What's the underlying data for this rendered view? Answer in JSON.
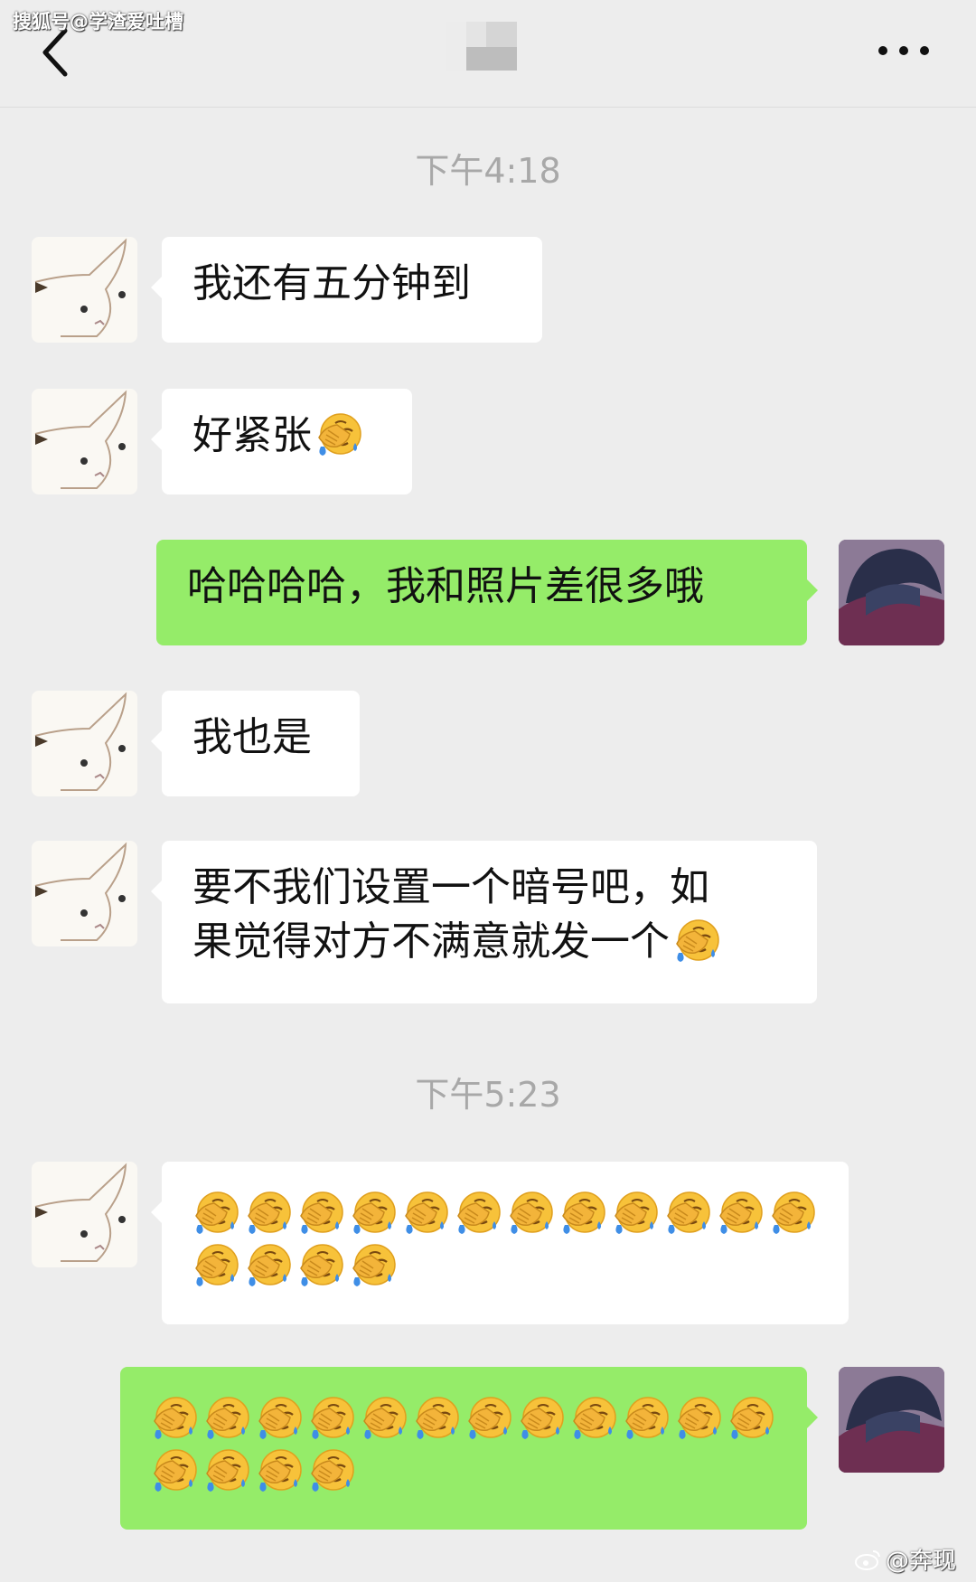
{
  "watermark_top": "搜狐号@学渣爱吐槽",
  "watermark_bottom": "@奔现",
  "timestamps": [
    "下午4:18",
    "下午5:23"
  ],
  "messages": [
    {
      "side": "in",
      "text": "我还有五分钟到",
      "emoji_count": 0
    },
    {
      "side": "in",
      "text": "好紧张",
      "emoji_count": 1
    },
    {
      "side": "out",
      "text": "哈哈哈哈，我和照片差很多哦",
      "emoji_count": 0
    },
    {
      "side": "in",
      "text": "我也是",
      "emoji_count": 0
    },
    {
      "side": "in",
      "line1": "要不我们设置一个暗号吧，如",
      "line2": "果觉得对方不满意就发一个",
      "emoji_count": 1
    },
    {
      "side": "in",
      "text": "",
      "emoji_count": 16
    },
    {
      "side": "out",
      "text": "",
      "emoji_count": 16
    }
  ],
  "icons": {
    "back": "chevron-left-icon",
    "more": "more-dots-icon",
    "emoji": "facepalm-crying-emoji",
    "weibo": "weibo-logo"
  },
  "colors": {
    "background": "#ededed",
    "incoming_bubble": "#ffffff",
    "outgoing_bubble": "#95ec69",
    "timestamp": "#a8a8a8"
  }
}
